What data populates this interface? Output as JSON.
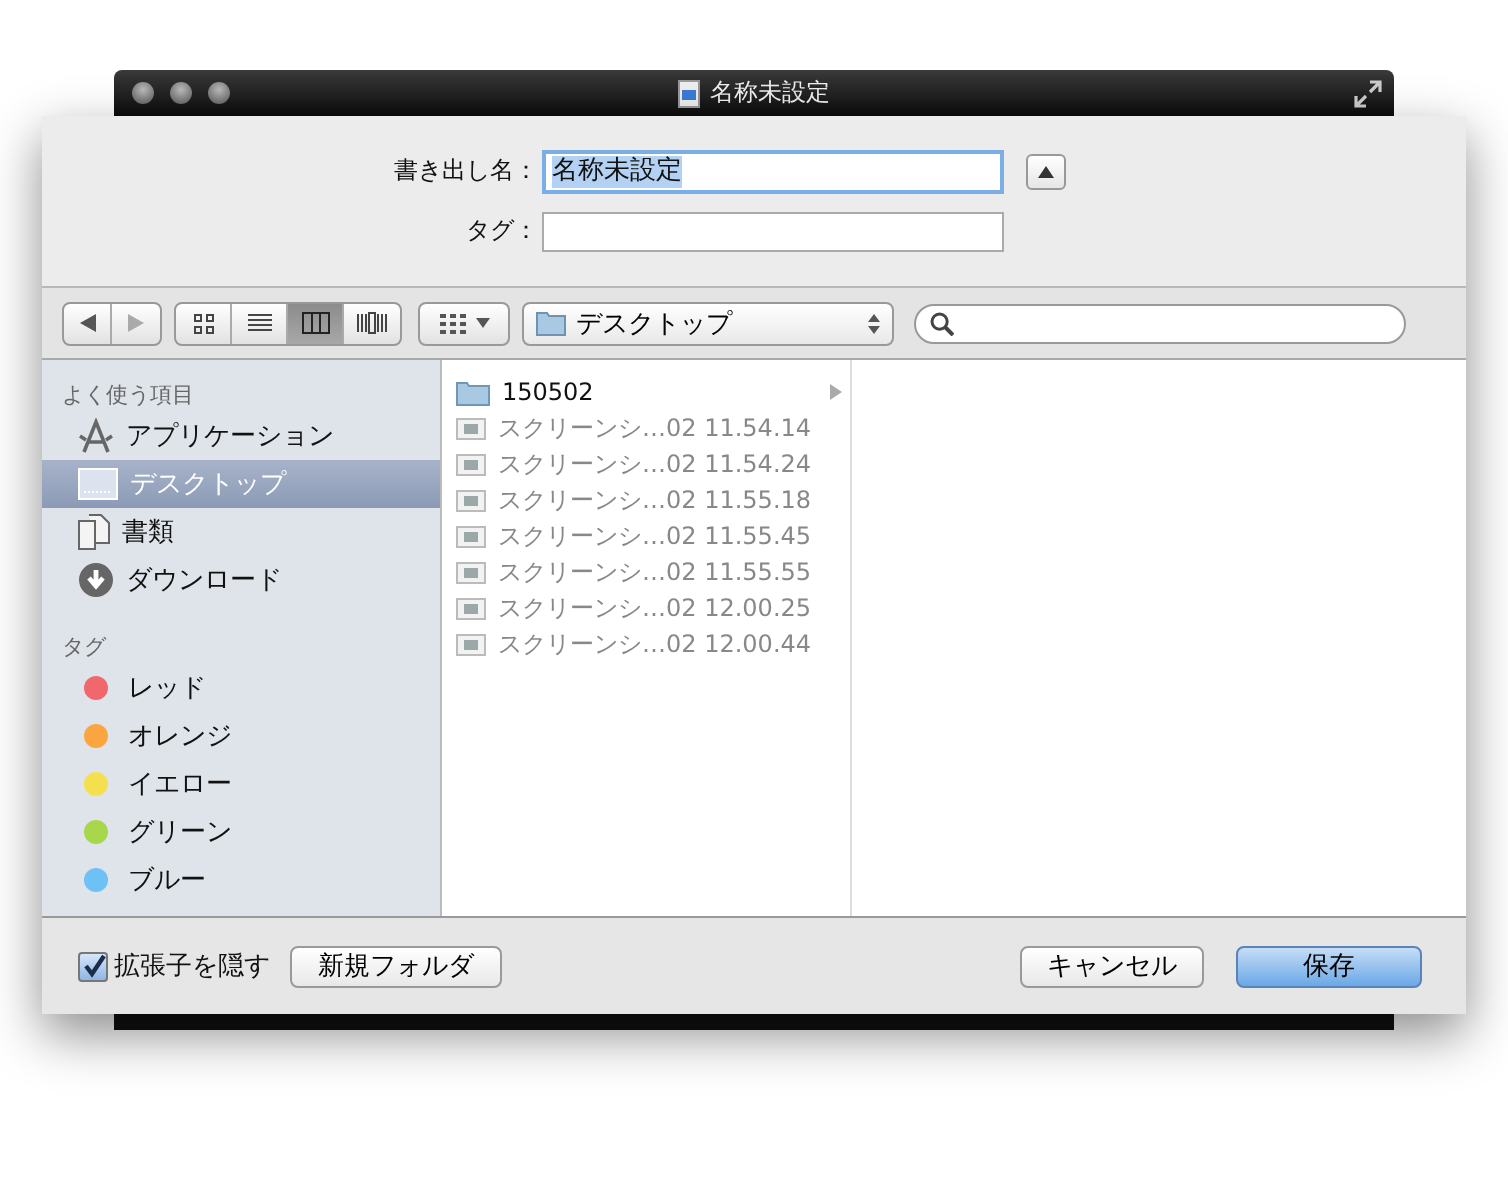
{
  "window": {
    "title": "名称未設定"
  },
  "form": {
    "name_label": "書き出し名：",
    "name_value": "名称未設定",
    "tags_label": "タグ："
  },
  "toolbar": {
    "view_modes": [
      {
        "kind": "icons",
        "selected": false
      },
      {
        "kind": "list",
        "selected": false
      },
      {
        "kind": "columns",
        "selected": true
      },
      {
        "kind": "coverflow",
        "selected": false
      }
    ],
    "location": "デスクトップ"
  },
  "sidebar": {
    "favorites_heading": "よく使う項目",
    "favorites": [
      {
        "kind": "apps",
        "label": "アプリケーション",
        "selected": false
      },
      {
        "kind": "desktop",
        "label": "デスクトップ",
        "selected": true
      },
      {
        "kind": "documents",
        "label": "書類",
        "selected": false
      },
      {
        "kind": "downloads",
        "label": "ダウンロード",
        "selected": false
      }
    ],
    "tags_heading": "タグ",
    "tags": [
      {
        "label": "レッド",
        "color": "#f0686b"
      },
      {
        "label": "オレンジ",
        "color": "#fba541"
      },
      {
        "label": "イエロー",
        "color": "#f4e04e"
      },
      {
        "label": "グリーン",
        "color": "#a7d84c"
      },
      {
        "label": "ブルー",
        "color": "#6ec1f5"
      }
    ]
  },
  "files": [
    {
      "kind": "folder",
      "name": "150502",
      "disabled": false
    },
    {
      "kind": "image",
      "name": "スクリーンシ…02 11.54.14",
      "disabled": true
    },
    {
      "kind": "image",
      "name": "スクリーンシ…02 11.54.24",
      "disabled": true
    },
    {
      "kind": "image",
      "name": "スクリーンシ…02 11.55.18",
      "disabled": true
    },
    {
      "kind": "image",
      "name": "スクリーンシ…02 11.55.45",
      "disabled": true
    },
    {
      "kind": "image",
      "name": "スクリーンシ…02 11.55.55",
      "disabled": true
    },
    {
      "kind": "image",
      "name": "スクリーンシ…02 12.00.25",
      "disabled": true
    },
    {
      "kind": "image",
      "name": "スクリーンシ…02 12.00.44",
      "disabled": true
    }
  ],
  "footer": {
    "hide_extension": {
      "label": "拡張子を隠す",
      "checked": true
    },
    "new_folder": "新規フォルダ",
    "cancel": "キャンセル",
    "save": "保存"
  }
}
